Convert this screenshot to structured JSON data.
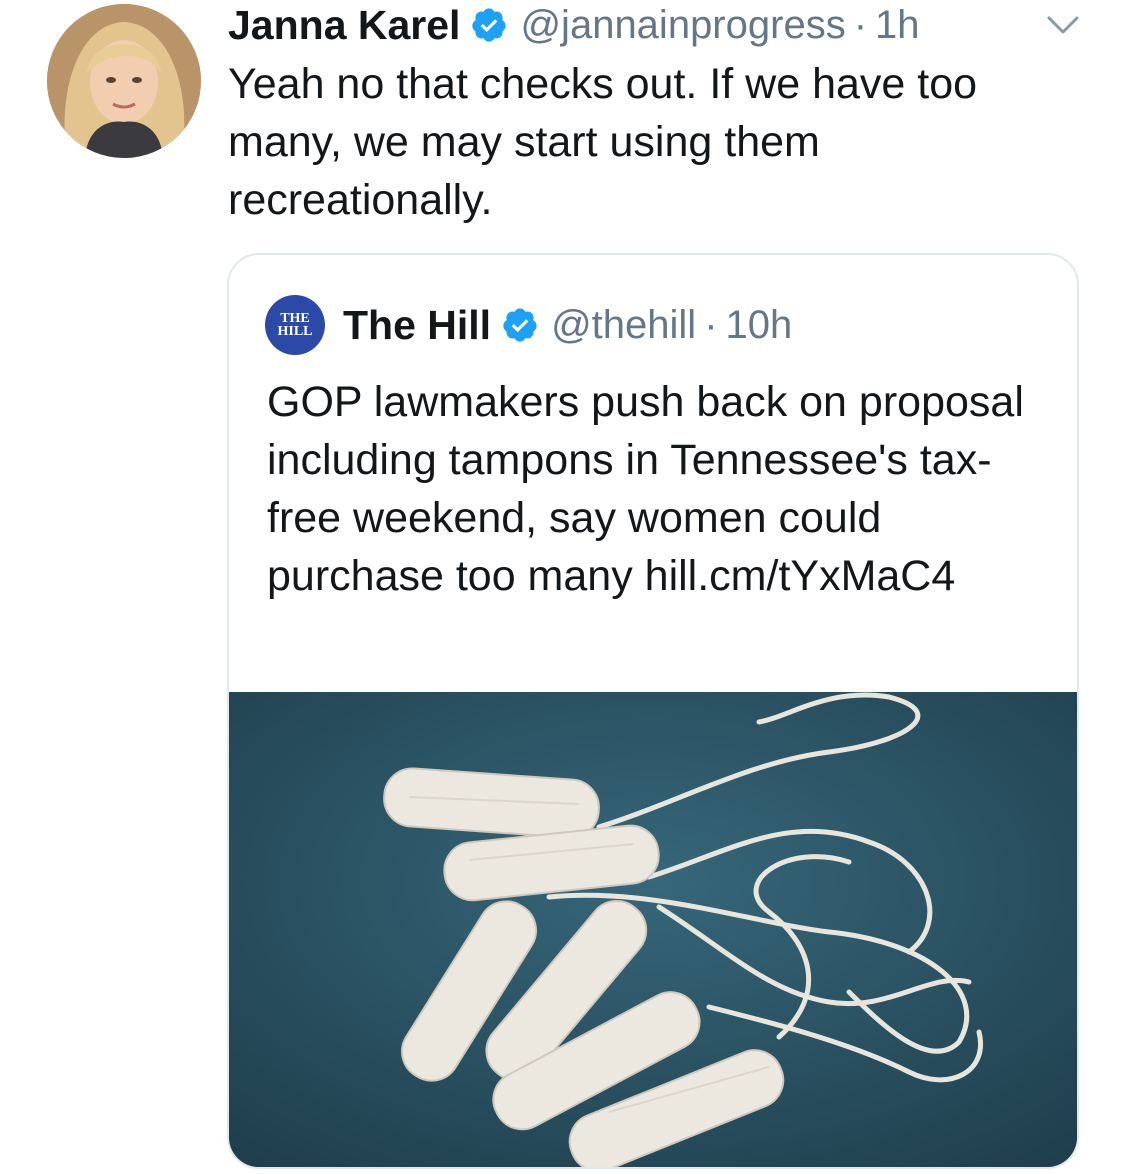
{
  "tweet": {
    "author_name": "Janna Karel",
    "handle": "@jannainprogress",
    "separator": "·",
    "time": "1h",
    "text": "Yeah no that checks out. If we have too many, we may start using them recreationally.",
    "avatar_icon": "profile-photo-avatar",
    "verified_icon": "verified-badge-icon",
    "menu_icon": "chevron-down-icon"
  },
  "quoted_tweet": {
    "logo_text_line1": "THE",
    "logo_text_line2": "HILL",
    "author_name": "The Hill",
    "handle": "@thehill",
    "separator": "·",
    "time": "10h",
    "text": "GOP lawmakers push back on proposal including tampons in Tennessee's tax-free weekend, say women could purchase too many hill.cm/tYxMaC4",
    "media_icon": "tampons-photo"
  },
  "colors": {
    "text_primary": "#14171a",
    "text_secondary": "#657786",
    "verified_blue": "#1da1f2",
    "card_border": "#e1e8ed",
    "hill_logo_blue": "#2b4aa8",
    "photo_background": "#2e5566"
  }
}
